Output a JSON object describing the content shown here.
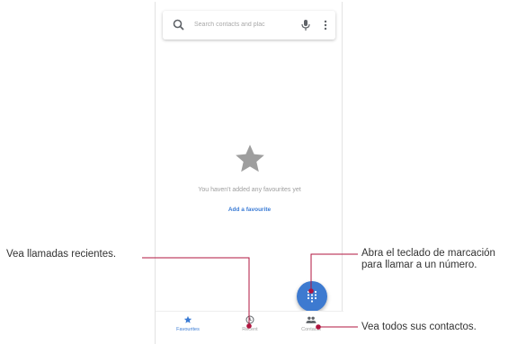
{
  "phone": {
    "search": {
      "placeholder": "Search contacts and plac"
    },
    "empty_state": {
      "message": "You haven't added any favourites yet",
      "add_link": "Add a favourite"
    },
    "bottom_nav": [
      {
        "label": "Favourites",
        "icon": "star-icon",
        "active": true
      },
      {
        "label": "Recent",
        "icon": "clock-icon",
        "active": false
      },
      {
        "label": "Contacts",
        "icon": "people-icon",
        "active": false
      }
    ],
    "fab_icon": "dialpad-icon"
  },
  "callouts": {
    "recent": "Vea llamadas recientes.",
    "dialpad_line1": "Abra el teclado de marcación",
    "dialpad_line2": "para llamar a un número.",
    "contacts": "Vea todos sus contactos."
  },
  "colors": {
    "accent": "#3d7ad0",
    "leader": "#b0153f",
    "star_gray": "#9e9e9e"
  }
}
